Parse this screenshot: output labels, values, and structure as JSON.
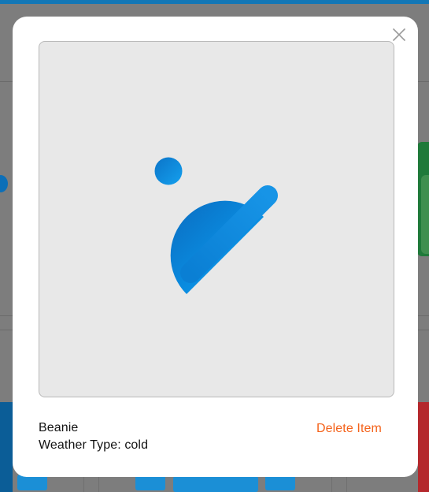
{
  "item": {
    "name": "Beanie",
    "weather_label": "Weather Type: cold",
    "image_icon": "beanie-icon"
  },
  "actions": {
    "delete_label": "Delete Item",
    "close_icon": "close-icon"
  },
  "colors": {
    "accent": "#f4621a",
    "beanie_blue": "#0a8ce0",
    "image_bg": "#e8e8e8",
    "overlay": "#7d7d7d"
  }
}
